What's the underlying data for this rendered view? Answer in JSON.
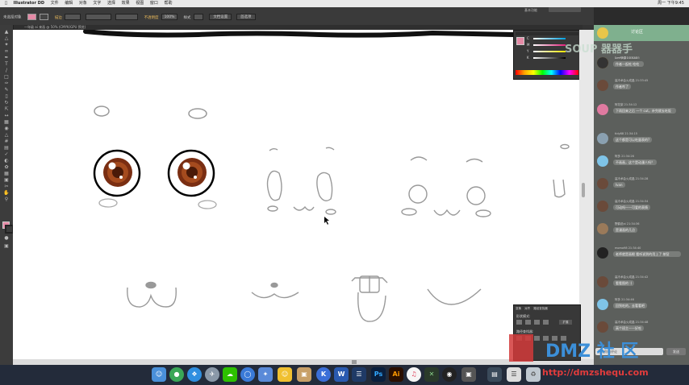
{
  "menubar": {
    "app": "Illustrator DD",
    "items": [
      "文件",
      "编辑",
      "对象",
      "文字",
      "选择",
      "效果",
      "视图",
      "窗口",
      "帮助"
    ],
    "clock": "周一 下午9:45"
  },
  "control_bar": {
    "label_none": "未选择对象",
    "stroke_label": "描边",
    "opacity_label": "不透明度",
    "opacity_value": "100%",
    "style_label": "样式",
    "doc_setup": "文档设置",
    "prefs": "首选项",
    "workspace": "基本功能"
  },
  "document_tab": {
    "title": "一年级 ai 来画 @ 50% (CMYK/GPU 预览)"
  },
  "swatch_panel": {
    "channels": [
      "C",
      "M",
      "Y",
      "K"
    ]
  },
  "path_panel": {
    "tabs": [
      "变换",
      "对齐",
      "路径查找器"
    ],
    "shape_modes": "形状模式:",
    "pathfinders": "路径查找器:",
    "expand_button": "扩展"
  },
  "chat": {
    "header": "讨论区",
    "messages": [
      {
        "name": "1  一节课",
        "time": "21:32:45",
        "text": "太无聊了...一节课"
      },
      {
        "name": "Lavish",
        "time": "21:33:43",
        "text": "作者一起吃 吃吃"
      },
      {
        "name": "高冷术会火成晶",
        "time": "21:33:45",
        "text": "作者咋了"
      },
      {
        "name": "阿花梨",
        "time": "21:34:12",
        "text": "下雨回来之后 一个 cut，补完就去吃饭"
      },
      {
        "name": "tidy88",
        "time": "21:34:15",
        "text": "这个都是可以吃量表的?"
      },
      {
        "name": "阿多",
        "time": "21:34:26",
        "text": "不画画，这个是动漫人吗？"
      },
      {
        "name": "高冷术会火成晶",
        "time": "21:34:28",
        "text": "Ivan"
      },
      {
        "name": "高冷术会火成晶",
        "time": "21:34:34",
        "text": "可动吗——可爱的表情"
      },
      {
        "name": "野鹤说ai",
        "time": "21:34:36",
        "text": "是漫画的几点"
      },
      {
        "name": "momo98",
        "time": "21:34:40",
        "text": "老师就是画眼 看听说到的用上了 按钮"
      },
      {
        "name": "高冷术会火成晶",
        "time": "21:34:42",
        "text": "看看图的 :)"
      },
      {
        "name": "阿多",
        "time": "21:34:46",
        "text": "回到吃的，去看看吧"
      },
      {
        "name": "高冷术会火成晶",
        "time": "21:34:48",
        "text": "高个班主——好吃"
      }
    ],
    "input_placeholder": "写入你的评论",
    "send": "发送"
  },
  "watermarks": {
    "top": "SOUP 器器手",
    "bottom_brand": "DMZ 社 区",
    "url": "http://dmzshequ.com"
  },
  "dock": {
    "icons": [
      "finder-icon",
      "chrome-icon",
      "safari-icon",
      "launchpad-icon",
      "wechat-icon",
      "qq-browser-icon",
      "kk-icon",
      "qq-icon",
      "box-icon",
      "keynote-icon",
      "wps-icon",
      "ps-icon",
      "ai-icon",
      "music-icon",
      "x-icon",
      "obs-icon",
      "screenshot-icon",
      "preview-icon",
      "trash-icon"
    ],
    "ps_label": "Ps",
    "ai_label": "Ai",
    "k_label": "K",
    "w_label": "W"
  }
}
